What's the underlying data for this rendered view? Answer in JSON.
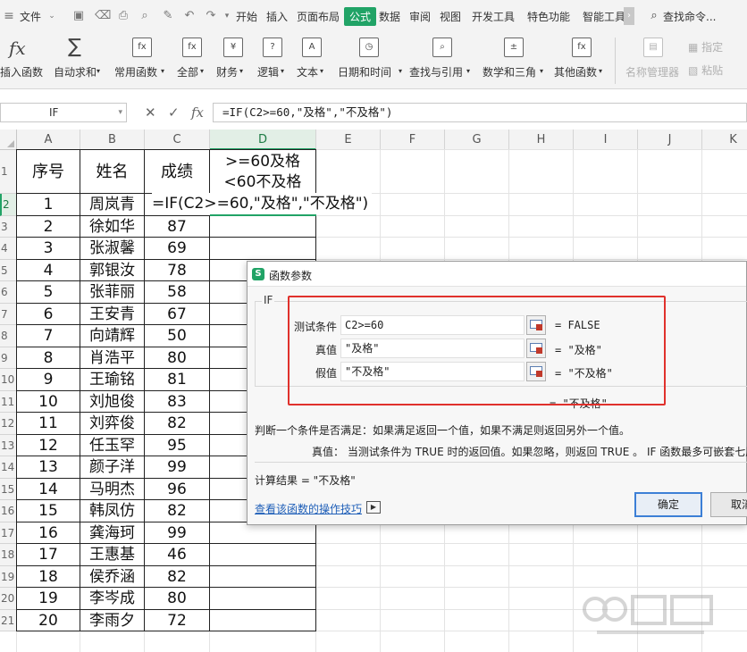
{
  "menubar": {
    "file_label": "文件",
    "tabs": [
      "开始",
      "插入",
      "页面布局",
      "公式",
      "数据",
      "审阅",
      "视图",
      "开发工具",
      "特色功能",
      "智能工具"
    ],
    "active_tab": "公式",
    "search_label": "查找命令..."
  },
  "ribbon": {
    "buttons": [
      {
        "label": "插入函数",
        "icon": "fx-icon"
      },
      {
        "label": "自动求和",
        "icon": "sigma-icon"
      },
      {
        "label": "常用函数",
        "icon": "star-fx-icon"
      },
      {
        "label": "全部",
        "icon": "fx-box-icon"
      },
      {
        "label": "财务",
        "icon": "yen-icon"
      },
      {
        "label": "逻辑",
        "icon": "question-icon"
      },
      {
        "label": "文本",
        "icon": "text-a-icon"
      },
      {
        "label": "日期和时间",
        "icon": "clock-icon"
      },
      {
        "label": "查找与引用",
        "icon": "magnifier-icon"
      },
      {
        "label": "数学和三角",
        "icon": "math-icon"
      },
      {
        "label": "其他函数",
        "icon": "more-fx-icon"
      }
    ],
    "disabled": {
      "name_manager": "名称管理器",
      "specify": "指定",
      "paste": "粘贴"
    }
  },
  "formula_bar": {
    "name_box": "IF",
    "cancel_icon": "✕",
    "confirm_icon": "✓",
    "fx_label": "fx",
    "formula": "=IF(C2>=60,\"及格\",\"不及格\")"
  },
  "sheet": {
    "columns": [
      "A",
      "B",
      "C",
      "D",
      "E",
      "F",
      "G",
      "H",
      "I",
      "J",
      "K"
    ],
    "selected_column": "D",
    "row_numbers": [
      "1",
      "2",
      "3",
      "4",
      "5",
      "6",
      "7",
      "8",
      "9",
      "10",
      "11",
      "12",
      "13",
      "14",
      "15",
      "16",
      "17",
      "18",
      "19",
      "20",
      "21"
    ],
    "header": {
      "a": "序号",
      "b": "姓名",
      "c": "成绩",
      "d1": ">=60及格",
      "d2": "<60不及格"
    },
    "editing_text": "=IF(C2>=60,\"及格\",\"不及格\")",
    "rows": [
      {
        "no": "1",
        "name": "周岚青",
        "score": ""
      },
      {
        "no": "2",
        "name": "徐如华",
        "score": "87"
      },
      {
        "no": "3",
        "name": "张淑馨",
        "score": "69"
      },
      {
        "no": "4",
        "name": "郭银汝",
        "score": "78"
      },
      {
        "no": "5",
        "name": "张菲丽",
        "score": "58"
      },
      {
        "no": "6",
        "name": "王安青",
        "score": "67"
      },
      {
        "no": "7",
        "name": "向靖辉",
        "score": "50"
      },
      {
        "no": "8",
        "name": "肖浩平",
        "score": "80"
      },
      {
        "no": "9",
        "name": "王瑜铭",
        "score": "81"
      },
      {
        "no": "10",
        "name": "刘旭俊",
        "score": "83"
      },
      {
        "no": "11",
        "name": "刘弈俊",
        "score": "82"
      },
      {
        "no": "12",
        "name": "任玉罕",
        "score": "95"
      },
      {
        "no": "13",
        "name": "颜子洋",
        "score": "99"
      },
      {
        "no": "14",
        "name": "马明杰",
        "score": "96"
      },
      {
        "no": "15",
        "name": "韩凤仿",
        "score": "82"
      },
      {
        "no": "16",
        "name": "龚海珂",
        "score": "99"
      },
      {
        "no": "17",
        "name": "王惠基",
        "score": "46"
      },
      {
        "no": "18",
        "name": "侯乔涵",
        "score": "82"
      },
      {
        "no": "19",
        "name": "李岑成",
        "score": "80"
      },
      {
        "no": "20",
        "name": "李雨夕",
        "score": "72"
      }
    ]
  },
  "dialog": {
    "title": "函数参数",
    "function_name": "IF",
    "params": [
      {
        "label": "测试条件",
        "value": "C2>=60",
        "result": "=  FALSE"
      },
      {
        "label": "真值",
        "value": "\"及格\"",
        "result": "=  \"及格\""
      },
      {
        "label": "假值",
        "value": "\"不及格\"",
        "result": "=  \"不及格\""
      }
    ],
    "overall_result": "=  \"不及格\"",
    "description": "判断一个条件是否满足：如果满足返回一个值，如果不满足则返回另外一个值。",
    "param_description": "真值：  当测试条件为 TRUE 时的返回值。如果忽略，则返回 TRUE 。 IF 函数最多可嵌套七层",
    "calc_result": "计算结果  =   \"不及格\"",
    "help_link": "查看该函数的操作技巧",
    "ok_label": "确定",
    "cancel_label": "取消"
  },
  "colors": {
    "accent": "#21a366",
    "highlight_box": "#e0312c",
    "link": "#1f5fb8"
  }
}
